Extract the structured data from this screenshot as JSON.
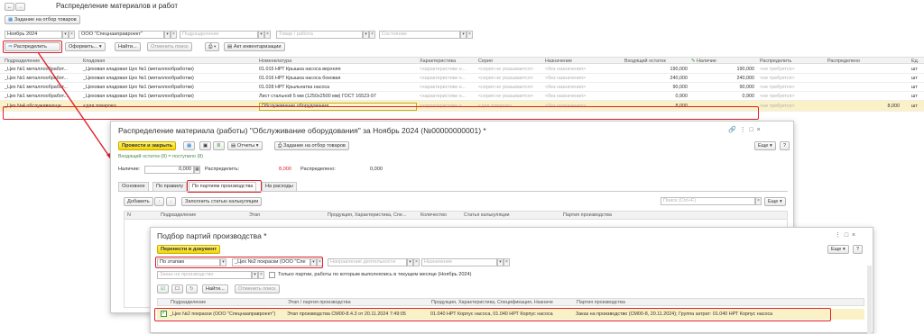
{
  "main": {
    "title": "Распределение материалов и работ",
    "task_button": "Задание на отбор товаров",
    "period": "Ноябрь 2024",
    "org": "ООО \"Спецнааправроект\"",
    "filter_placeholders": [
      "Подразделение",
      "Товар / работа",
      "Состояние"
    ],
    "toolbar": {
      "distribute": "Распределить",
      "format": "Оформить...",
      "find": "Найти...",
      "cancel_search": "Отменить поиск",
      "inventory": "Акт инвентаризации"
    },
    "columns": [
      "Подразделение",
      "Кладовая",
      "Номенклатура",
      "Характеристика",
      "Серия",
      "Назначение",
      "Входящий остаток",
      "Наличие",
      "Распределить",
      "Распределено",
      "Ед."
    ],
    "rows": [
      [
        "_Цех №1 металлообработ...",
        "_Цеховая кладовая Цех №1 (металлообработки)",
        "01.015 НРТ Крышка насоса верхняя",
        "<характеристики н...",
        "<серия не указывается>",
        "<без назначения>",
        "190,000",
        "190,000",
        "<не требуется>",
        "",
        "шт"
      ],
      [
        "_Цех №1 металлообработ...",
        "_Цеховая кладовая Цех №1 (металлообработки)",
        "01.016 НРТ Крышка насоса боковая",
        "<характеристики н...",
        "<серия не указывается>",
        "<без назначения>",
        "240,000",
        "240,000",
        "<не требуется>",
        "",
        "шт"
      ],
      [
        "_Цех №1 металлообработ...",
        "_Цеховая кладовая Цех №1 (металлообработки)",
        "01.028 НРТ Крыльчатка насоса",
        "<характеристики н...",
        "<серия не указывается>",
        "<без назначения>",
        "90,000",
        "90,000",
        "<не требуется>",
        "",
        "шт"
      ],
      [
        "_Цех №1 металлообработ...",
        "_Цеховая кладовая Цех №1 (металлообработки)",
        "Лист стальной 5 мм (1250х2500 мм) ГОСТ 16523-97",
        "<характеристики н...",
        "<серия не указывается>",
        "<без назначения>",
        "0,900",
        "0,900",
        "<не требуется>",
        "",
        "шт"
      ],
      [
        "_Цех №4 обслуживающе ...",
        "<для товаров>",
        "Обслуживание оборудования",
        "<характеристики н...",
        "<для товаров>",
        "<без назначения>",
        "8,000",
        "",
        "<не требуется>",
        "8,000",
        "шт"
      ]
    ]
  },
  "doc": {
    "title": "Распределение материала (работы) \"Обслуживание оборудования\" за Ноябрь 2024 (№00000000001) *",
    "post_close": "Провести и закрыть",
    "reports": "Отчеты",
    "task_button": "Задание на отбор товаров",
    "more": "Еще",
    "help": "?",
    "incoming_note": "Входящий остаток (8) = поступило (8)",
    "availability_label": "Наличие:",
    "availability_value": "0,000",
    "distribute_label": "Распределить:",
    "distribute_value": "8,000",
    "distributed_label": "Распределено:",
    "distributed_value": "0,000",
    "tabs": [
      "Основное",
      "По правилу",
      "По партиям производства",
      "На расходы"
    ],
    "add": "Добавить",
    "fill_articles": "Заполнить статью калькуляции",
    "search_placeholder": "Поиск (Ctrl+F)",
    "columns": [
      "N",
      "Подразделение",
      "Этап",
      "Продукция, Характеристика, Спе...",
      "Количество",
      "Статья калькуляции",
      "Партия производства"
    ]
  },
  "picker": {
    "title": "Подбор партий производства *",
    "transfer": "Перенести в документ",
    "more": "Еще",
    "help": "?",
    "by_stages": "По этапам",
    "division": "_Цех №2 покраски (ООО \"Спе",
    "activity_placeholder": "Направление деятельности",
    "purpose_placeholder": "Назначение",
    "order_placeholder": "Заказ на производство",
    "checkbox_label": "Только партии, работы по которым выполнялись в текущем месяце (Ноябрь 2024)",
    "find": "Найти...",
    "cancel_search": "Отменить поиск",
    "columns": [
      "Подразделение",
      "Этап / партия производства",
      "Продукция, Характеристика, Спецификация, Назначе",
      "Партия производства"
    ],
    "row": {
      "division": "_Цех №2 покраски (ООО \"Спецнааправроект\")",
      "stage": "Этап производства СМ00-8.4.3 от 20.11.2024 7:49:05",
      "product": "01.040 НРТ Корпус насоса, 01.040 НРТ Корпус насоса",
      "batch": "Заказ на производство (СМ00-8, 20.11.2024); Группа затрат: 01.040 НРТ Корпус насоса"
    }
  },
  "colors": {
    "highlight_red": "#e0202a",
    "selected_row": "#fbf1c7",
    "accent_yellow": "#f3d500"
  }
}
